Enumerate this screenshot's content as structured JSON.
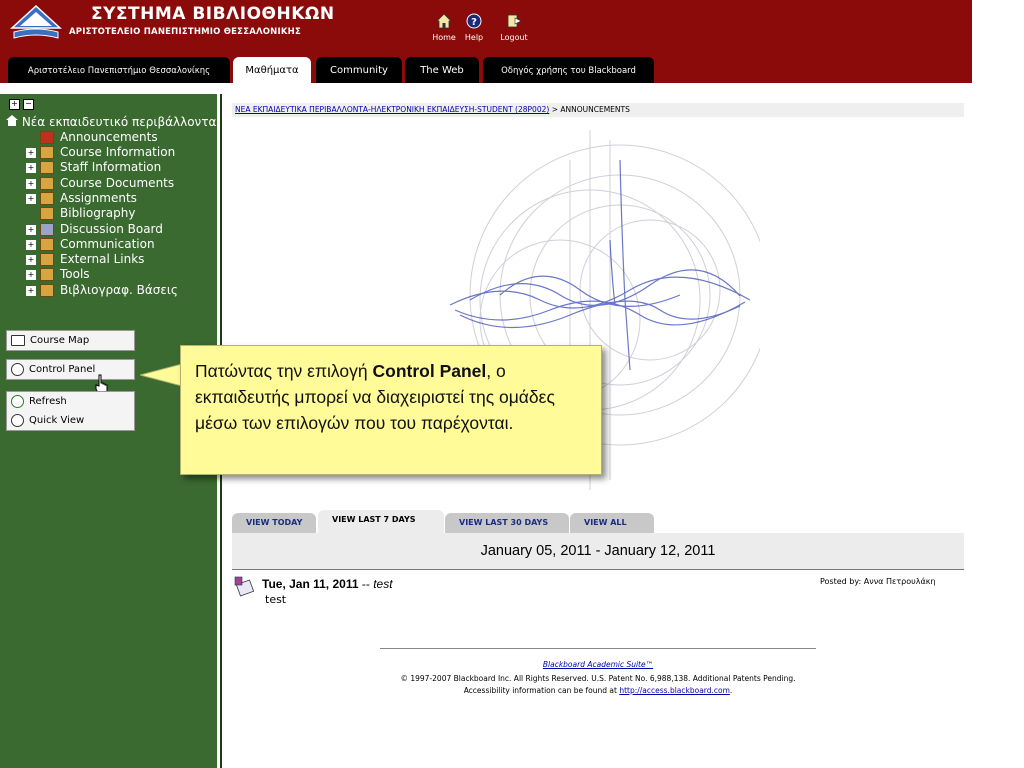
{
  "header": {
    "title": "ΣΥΣΤΗΜΑ ΒΙΒΛΙΟΘΗΚΩΝ",
    "subtitle": "ΑΡΙΣΤΟΤΕΛΕΙΟ ΠΑΝΕΠΙΣΤΗΜΙΟ ΘΕΣΣΑΛΟΝΙΚΗΣ",
    "buttons": [
      {
        "label": "Home",
        "icon": "home-icon"
      },
      {
        "label": "Help",
        "icon": "help-icon"
      },
      {
        "label": "Logout",
        "icon": "logout-icon"
      }
    ],
    "colors": {
      "brand": "#8b0a0a",
      "tab_bg": "#000000"
    }
  },
  "tabs": [
    {
      "label": "Αριστοτέλειο Πανεπιστήμιο Θεσσαλονίκης",
      "active": false
    },
    {
      "label": "Μαθήματα",
      "active": true
    },
    {
      "label": "Community",
      "active": false
    },
    {
      "label": "The Web",
      "active": false
    },
    {
      "label": "Οδηγός χρήσης του Blackboard",
      "active": false
    }
  ],
  "sidebar": {
    "root_label": "Νέα εκπαιδευτικό περιβάλλοντα",
    "items": [
      {
        "label": "Announcements",
        "expandable": false
      },
      {
        "label": "Course Information",
        "expandable": true
      },
      {
        "label": "Staff Information",
        "expandable": true
      },
      {
        "label": "Course Documents",
        "expandable": true
      },
      {
        "label": "Assignments",
        "expandable": true
      },
      {
        "label": "Bibliography",
        "expandable": false
      },
      {
        "label": "Discussion Board",
        "expandable": true
      },
      {
        "label": "Communication",
        "expandable": true
      },
      {
        "label": "External Links",
        "expandable": true
      },
      {
        "label": "Tools",
        "expandable": true
      },
      {
        "label": "Βιβλιογραφ. Βάσεις",
        "expandable": true
      }
    ],
    "course_map": "Course Map",
    "control_panel": "Control Panel",
    "refresh": "Refresh",
    "quick_view": "Quick View",
    "colors": {
      "bg": "#3a6a30"
    }
  },
  "breadcrumb": {
    "link": "ΝΕΑ ΕΚΠΑΙΔΕΥΤΙΚΑ ΠΕΡΙΒΑΛΛΟΝΤΑ-ΗΛΕΚΤΡΟΝΙΚΗ ΕΚΠΑΙΔΕΥΣΗ-STUDENT (28P002)",
    "separator": ">",
    "current": "ANNOUNCEMENTS"
  },
  "callout": {
    "before": "Πατώντας την επιλογή ",
    "bold": "Control Panel",
    "after": ", ο εκπαιδευτής μπορεί να διαχειριστεί της ομάδες μέσω των επιλογών που του παρέχονται."
  },
  "view_tabs": [
    {
      "label": "VIEW TODAY",
      "active": false
    },
    {
      "label": "VIEW LAST 7 DAYS",
      "active": true
    },
    {
      "label": "VIEW LAST 30 DAYS",
      "active": false
    },
    {
      "label": "VIEW ALL",
      "active": false
    }
  ],
  "date_range": "January 05, 2011 - January 12, 2011",
  "announcement": {
    "date": "Tue, Jan 11, 2011",
    "dash": " -- ",
    "title": "test",
    "body": "test",
    "posted_by": "Posted by: Αννα Πετρουλάκη"
  },
  "footer": {
    "suite": "Blackboard Academic Suite™",
    "copyright": "© 1997-2007 Blackboard Inc. All Rights Reserved. U.S. Patent No. 6,988,138. Additional Patents Pending.",
    "access_text": "Accessibility information can be found at ",
    "access_link": "http://access.blackboard.com",
    "access_end": "."
  }
}
